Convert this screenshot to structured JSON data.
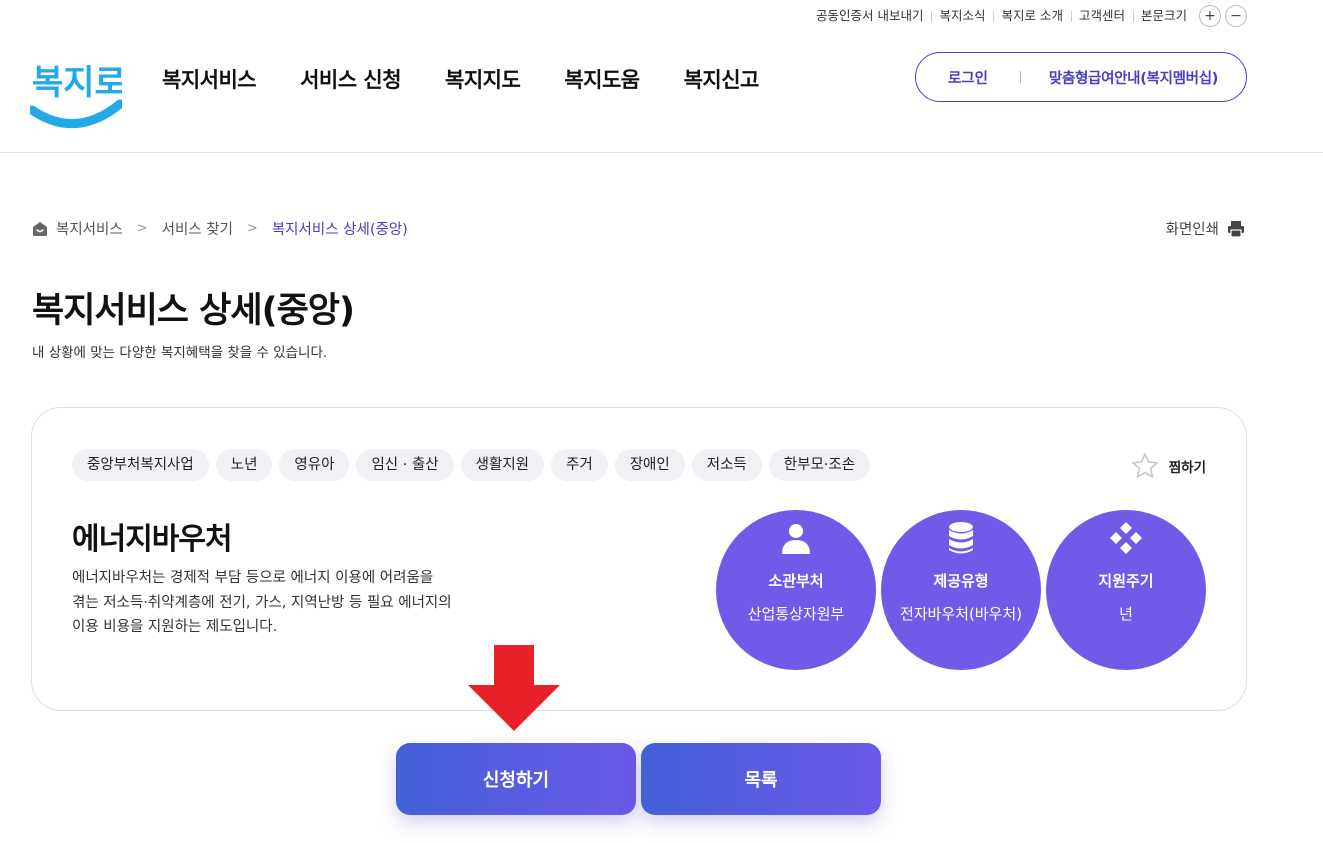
{
  "utility": {
    "items": [
      "공동인증서 내보내기",
      "복지소식",
      "복지로 소개",
      "고객센터"
    ],
    "font_size_label": "본문크기",
    "zoom_in": "+",
    "zoom_out": "−"
  },
  "header": {
    "logo_text": "복지로",
    "nav": [
      "복지서비스",
      "서비스 신청",
      "복지지도",
      "복지도움",
      "복지신고"
    ],
    "login": "로그인",
    "membership": "맞춤형급여안내(복지멤버십)"
  },
  "breadcrumb": {
    "items": [
      "복지서비스",
      "서비스 찾기",
      "복지서비스 상세(중앙)"
    ]
  },
  "print_label": "화면인쇄",
  "page": {
    "title": "복지서비스 상세(중앙)",
    "subtitle": "내 상황에 맞는 다양한 복지혜택을 찾을 수 있습니다."
  },
  "service": {
    "tags": [
      "중앙부처복지사업",
      "노년",
      "영유아",
      "임신 · 출산",
      "생활지원",
      "주거",
      "장애인",
      "저소득",
      "한부모·조손"
    ],
    "wish_label": "찜하기",
    "name": "에너지바우처",
    "description": "에너지바우처는 경제적 부담 등으로 에너지 이용에 어려움을 겪는 저소득·취약계층에 전기, 가스, 지역난방 등 필요 에너지의 이용 비용을 지원하는 제도입니다.",
    "info": [
      {
        "label": "소관부처",
        "value": "산업통상자원부",
        "icon": "person-icon"
      },
      {
        "label": "제공유형",
        "value": "전자바우처(바우처)",
        "icon": "database-icon"
      },
      {
        "label": "지원주기",
        "value": "년",
        "icon": "cycle-icon"
      }
    ]
  },
  "buttons": {
    "apply": "신청하기",
    "list": "목록"
  },
  "colors": {
    "accent": "#4a3fc4",
    "circle": "#715ae8",
    "arrow": "#e8202a",
    "logo_blue": "#22a9e8"
  }
}
